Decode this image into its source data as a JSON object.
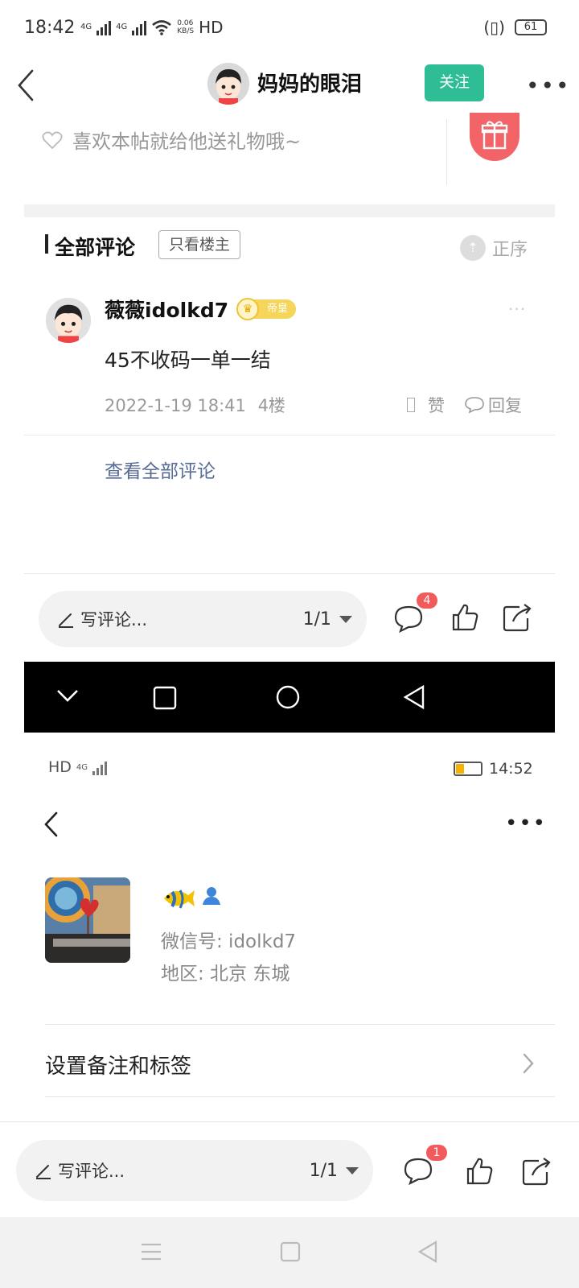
{
  "status_bar": {
    "time": "18:42",
    "net1": "4G",
    "net2": "4G",
    "speed": "0.06",
    "speed_unit": "KB/S",
    "hd": "HD",
    "battery": "61"
  },
  "post_header": {
    "title": "妈妈的眼泪",
    "follow_label": "关注"
  },
  "gift": {
    "prompt": "喜欢本帖就给他送礼物哦~"
  },
  "comments": {
    "title": "全部评论",
    "only_owner": "只看楼主",
    "order": "正序",
    "item": {
      "user": "薇薇idolkd7",
      "badge": "帝皇",
      "text": "45不收码一单一结",
      "date": "2022-1-19 18:41",
      "floor": "4楼",
      "like": "赞",
      "reply": "回复"
    },
    "view_all": "查看全部评论"
  },
  "bottom_bar_1": {
    "write": "写评论...",
    "page": "1/1",
    "comment_count": "4"
  },
  "status_bar_2": {
    "hd": "HD",
    "net": "4G",
    "time": "14:52"
  },
  "profile": {
    "wechat_id": "微信号: idolkd7",
    "region": "地区: 北京  东城",
    "set_remark": "设置备注和标签"
  },
  "bottom_bar_2": {
    "write": "写评论...",
    "page": "1/1",
    "comment_count": "1"
  },
  "colors": {
    "accent_green": "#2ebd95",
    "link_blue": "#576b95",
    "badge_red": "#f25b5b",
    "gift_red": "#f26467"
  }
}
